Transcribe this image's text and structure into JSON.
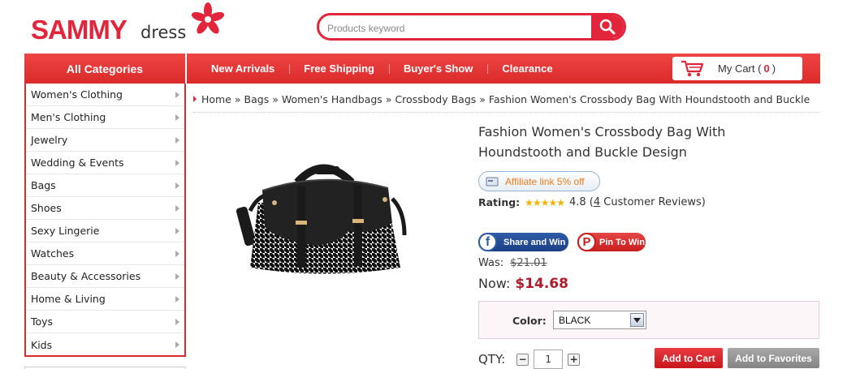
{
  "header": {
    "logo_main": "SAMMY",
    "logo_sub": "dress",
    "search_placeholder": "Products keyword"
  },
  "nav": {
    "all_categories": "All Categories",
    "links": [
      "New Arrivals",
      "Free Shipping",
      "Buyer's Show",
      "Clearance"
    ],
    "cart_label": "My Cart",
    "cart_count": "0"
  },
  "sidebar": {
    "items": [
      "Women's Clothing",
      "Men's Clothing",
      "Jewelry",
      "Wedding & Events",
      "Bags",
      "Shoes",
      "Sexy Lingerie",
      "Watches",
      "Beauty & Accessories",
      "Home & Living",
      "Toys",
      "Kids"
    ]
  },
  "breadcrumb": {
    "items": [
      "Home",
      "Bags",
      "Women's Handbags",
      "Crossbody Bags",
      "Fashion Women's Crossbody Bag With Houndstooth and Buckle"
    ],
    "separator": "»"
  },
  "product": {
    "title": "Fashion Women's Crossbody Bag With Houndstooth and Buckle Design",
    "affiliate": "Affiliate link 5% off",
    "rating_label": "Rating:",
    "rating_value": "4.8",
    "review_count": "4",
    "review_text": "Customer Reviews",
    "rating_stars": 4.8,
    "share_fb": "Share and Win",
    "share_pin": "Pin To Win",
    "was_label": "Was:",
    "was_price": "$21.01",
    "now_label": "Now:",
    "now_price": "$14.68",
    "color_label": "Color:",
    "color_value": "BLACK",
    "qty_label": "QTY:",
    "qty_value": "1",
    "add_to_cart": "Add to Cart",
    "add_to_favorites": "Add to Favorites"
  },
  "colors": {
    "brand_red": "#e2253a",
    "price_red": "#b01c2c"
  }
}
